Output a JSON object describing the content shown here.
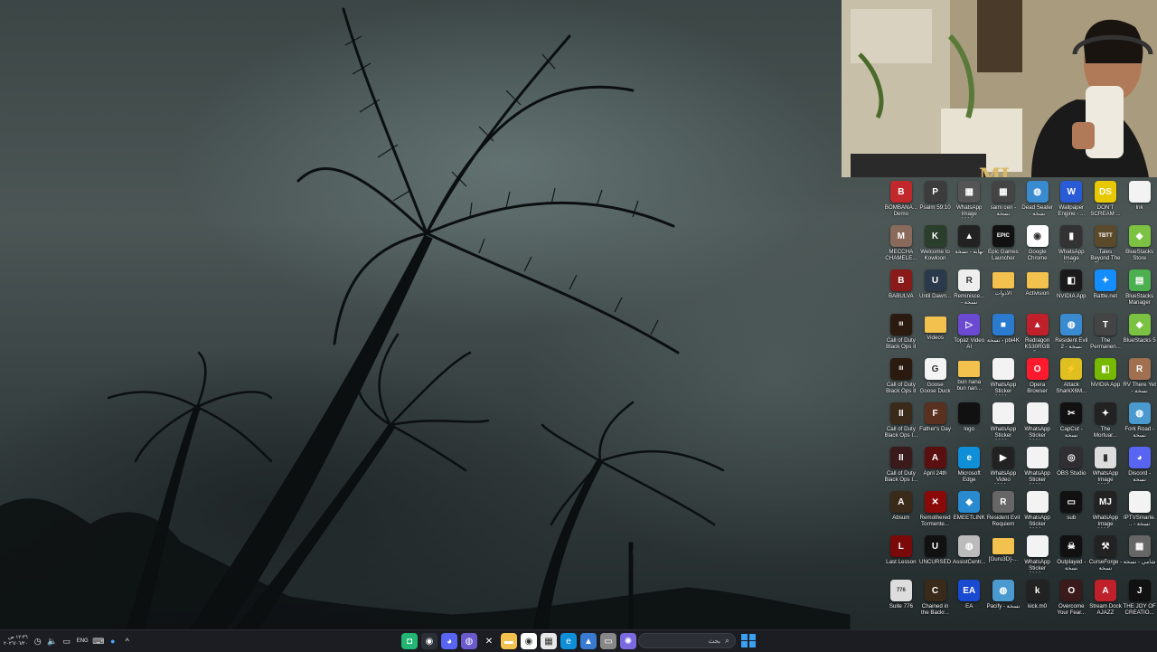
{
  "taskbar": {
    "clock_time": "١٢:٣٦ ص",
    "clock_date": "٢٠٢٦/٠٦/٢٠",
    "language": "ENG",
    "search_placeholder": "بحث"
  },
  "colors": {
    "taskbar_bg": "#1b1d22",
    "accent_start": "#3aa0f0"
  },
  "webcam": {
    "overlay_logo": "MJ"
  },
  "desktop_icons": [
    {
      "label": "BOMBANA... Demo",
      "icon": "game-icon",
      "bg": "#c0282b",
      "glyph": "B"
    },
    {
      "label": "Psalm 59:10",
      "icon": "app-icon",
      "bg": "#3c3c3c",
      "glyph": "P"
    },
    {
      "label": "WhatsApp Image 2026...",
      "icon": "image-icon",
      "bg": "#555",
      "glyph": "▦"
    },
    {
      "label": "sami cen - نسخة",
      "icon": "image-icon",
      "bg": "#444",
      "glyph": "▦"
    },
    {
      "label": "Dead Seater - نسخة",
      "icon": "globe-icon",
      "bg": "#3a8ad0",
      "glyph": "◍"
    },
    {
      "label": "Wallpaper Engine - ...",
      "icon": "wallpaper-engine-icon",
      "bg": "#2a5bd7",
      "glyph": "W"
    },
    {
      "label": "DON'T SCREAM ...",
      "icon": "game-icon",
      "bg": "#e8c800",
      "glyph": "DS"
    },
    {
      "label": "lnk",
      "icon": "file-icon",
      "bg": "#f3f3f3",
      "glyph": ""
    },
    {
      "label": "MECCHA CHAMELE...",
      "icon": "game-icon",
      "bg": "#8a6a5a",
      "glyph": "M"
    },
    {
      "label": "Welcome to Kowloon",
      "icon": "game-icon",
      "bg": "#2b3d2b",
      "glyph": "K"
    },
    {
      "label": "نهاية - نسخة",
      "icon": "app-icon",
      "bg": "#222",
      "glyph": "▲"
    },
    {
      "label": "Epic Games Launcher",
      "icon": "epic-games-icon",
      "bg": "#111",
      "glyph": "EPIC"
    },
    {
      "label": "Google Chrome",
      "icon": "chrome-icon",
      "bg": "#ffffff",
      "glyph": "◉"
    },
    {
      "label": "WhatsApp Image 2026...",
      "icon": "image-icon",
      "bg": "#333",
      "glyph": "▮"
    },
    {
      "label": "Tales Beyond The Tomb -...",
      "icon": "game-icon",
      "bg": "#5a4a2a",
      "glyph": "TBTT"
    },
    {
      "label": "BlueStacks Store",
      "icon": "bluestacks-icon",
      "bg": "#7cc242",
      "glyph": "◆"
    },
    {
      "label": "BABULVA",
      "icon": "game-icon",
      "bg": "#8a1a1a",
      "glyph": "B"
    },
    {
      "label": "Until Dawn...",
      "icon": "game-icon",
      "bg": "#2a3a4a",
      "glyph": "U"
    },
    {
      "label": "Reminisce... - نسخة",
      "icon": "game-icon",
      "bg": "#eee",
      "glyph": "R"
    },
    {
      "label": "الأدوات",
      "icon": "folder-icon",
      "bg": "#f2c14e",
      "glyph": ""
    },
    {
      "label": "Activision",
      "icon": "folder-icon",
      "bg": "#f2c14e",
      "glyph": ""
    },
    {
      "label": "NVIDIA App",
      "icon": "nvidia-icon",
      "bg": "#1a1a1a",
      "glyph": "◧"
    },
    {
      "label": "Battle.net",
      "icon": "battlenet-icon",
      "bg": "#148eff",
      "glyph": "✦"
    },
    {
      "label": "BlueStacks Manager",
      "icon": "bluestacks-icon",
      "bg": "#4caf50",
      "glyph": "▤"
    },
    {
      "label": "Call of Duty Black Ops II",
      "icon": "game-icon",
      "bg": "#2a1a10",
      "glyph": "III"
    },
    {
      "label": "Videos",
      "icon": "folder-icon",
      "bg": "#f2c14e",
      "glyph": ""
    },
    {
      "label": "Topaz Video AI",
      "icon": "app-icon",
      "bg": "#6a4ad0",
      "glyph": "▷"
    },
    {
      "label": "نسخة - pbi4K",
      "icon": "app-icon",
      "bg": "#2a7ad0",
      "glyph": "■"
    },
    {
      "label": "Redragon K530RGB Pro",
      "icon": "app-icon",
      "bg": "#c0202a",
      "glyph": "▲"
    },
    {
      "label": "Resident Evil 2 - نسخة",
      "icon": "globe-icon",
      "bg": "#3a8ad0",
      "glyph": "◍"
    },
    {
      "label": "The Permanen...",
      "icon": "game-icon",
      "bg": "#444",
      "glyph": "T"
    },
    {
      "label": "BlueStacks 5",
      "icon": "bluestacks-icon",
      "bg": "#7cc242",
      "glyph": "◆"
    },
    {
      "label": "Call of Duty Black Ops II",
      "icon": "game-icon",
      "bg": "#2a1a10",
      "glyph": "III"
    },
    {
      "label": "Goose Goose Duck",
      "icon": "game-icon",
      "bg": "#f4f4f4",
      "glyph": "G"
    },
    {
      "label": "bun nana bun nan...",
      "icon": "folder-icon",
      "bg": "#f2c14e",
      "glyph": ""
    },
    {
      "label": "WhatsApp Sticker 2026...",
      "icon": "file-icon",
      "bg": "#f3f3f3",
      "glyph": ""
    },
    {
      "label": "Opera Browser",
      "icon": "opera-icon",
      "bg": "#ff1b2d",
      "glyph": "O"
    },
    {
      "label": "Attack SharkX6M...",
      "icon": "app-icon",
      "bg": "#e0c020",
      "glyph": "⚡"
    },
    {
      "label": "NVIDIA App",
      "icon": "nvidia-icon",
      "bg": "#76b900",
      "glyph": "◧"
    },
    {
      "label": "RV There Yet - نسخة",
      "icon": "game-icon",
      "bg": "#a07050",
      "glyph": "R"
    },
    {
      "label": "Call of Duty Black Ops I...",
      "icon": "game-icon",
      "bg": "#3a2a1a",
      "glyph": "II"
    },
    {
      "label": "Father's Day",
      "icon": "game-icon",
      "bg": "#5a3020",
      "glyph": "F"
    },
    {
      "label": "logo",
      "icon": "image-icon",
      "bg": "#111",
      "glyph": ""
    },
    {
      "label": "WhatsApp Sticker 2026...",
      "icon": "file-icon",
      "bg": "#f3f3f3",
      "glyph": ""
    },
    {
      "label": "WhatsApp Sticker 2026...",
      "icon": "file-icon",
      "bg": "#f3f3f3",
      "glyph": ""
    },
    {
      "label": "CapCut - نسخة",
      "icon": "capcut-icon",
      "bg": "#111",
      "glyph": "✂"
    },
    {
      "label": "The Mortuar...",
      "icon": "game-icon",
      "bg": "#222",
      "glyph": "✦"
    },
    {
      "label": "Fork Road - نسخة",
      "icon": "globe-icon",
      "bg": "#4a9ad0",
      "glyph": "◍"
    },
    {
      "label": "Call of Duty Black Ops I...",
      "icon": "game-icon",
      "bg": "#3a1a1a",
      "glyph": "II"
    },
    {
      "label": "April 24th",
      "icon": "game-icon",
      "bg": "#5a1010",
      "glyph": "A"
    },
    {
      "label": "Microsoft Edge",
      "icon": "edge-icon",
      "bg": "#0f8fd8",
      "glyph": "e"
    },
    {
      "label": "WhatsApp Video 2026-...",
      "icon": "video-icon",
      "bg": "#222",
      "glyph": "▶"
    },
    {
      "label": "WhatsApp Sticker 2026...",
      "icon": "file-icon",
      "bg": "#f3f3f3",
      "glyph": ""
    },
    {
      "label": "OBS Studio",
      "icon": "obs-icon",
      "bg": "#302e31",
      "glyph": "◎"
    },
    {
      "label": "WhatsApp Image 2026...",
      "icon": "image-icon",
      "bg": "#ddd",
      "glyph": "▮"
    },
    {
      "label": "Discord - نسخة",
      "icon": "discord-icon",
      "bg": "#5865f2",
      "glyph": "◕"
    },
    {
      "label": "Absum",
      "icon": "game-icon",
      "bg": "#3a2a1a",
      "glyph": "A"
    },
    {
      "label": "Remothered Tormente...",
      "icon": "game-icon",
      "bg": "#8a0a0a",
      "glyph": "✕"
    },
    {
      "label": "EMEETLINK",
      "icon": "app-icon",
      "bg": "#2a8ad0",
      "glyph": "◆"
    },
    {
      "label": "Resident Evil Requiem",
      "icon": "game-icon",
      "bg": "#666",
      "glyph": "R"
    },
    {
      "label": "WhatsApp Sticker 2026...",
      "icon": "file-icon",
      "bg": "#f3f3f3",
      "glyph": ""
    },
    {
      "label": "sub",
      "icon": "app-icon",
      "bg": "#111",
      "glyph": "▭"
    },
    {
      "label": "WhatsApp Image 2026...",
      "icon": "image-icon",
      "bg": "#222",
      "glyph": "MJ"
    },
    {
      "label": "IPTVSmarte... - نسخة",
      "icon": "file-icon",
      "bg": "#f3f3f3",
      "glyph": ""
    },
    {
      "label": "Last Lesson",
      "icon": "game-icon",
      "bg": "#7a0a0a",
      "glyph": "L"
    },
    {
      "label": "UNCURSED",
      "icon": "game-icon",
      "bg": "#111",
      "glyph": "U"
    },
    {
      "label": "AssistCentr...",
      "icon": "app-icon",
      "bg": "#bbb",
      "glyph": "◍"
    },
    {
      "label": "[Guru3D]-...",
      "icon": "folder-icon",
      "bg": "#f2c14e",
      "glyph": ""
    },
    {
      "label": "WhatsApp Sticker 2026...",
      "icon": "file-icon",
      "bg": "#f3f3f3",
      "glyph": ""
    },
    {
      "label": "Outplayed - نسخة",
      "icon": "app-icon",
      "bg": "#111",
      "glyph": "☠"
    },
    {
      "label": "CurseForge - نسخة",
      "icon": "curseforge-icon",
      "bg": "#222",
      "glyph": "⚒"
    },
    {
      "label": "شامي - نسخة",
      "icon": "image-icon",
      "bg": "#666",
      "glyph": "▦"
    },
    {
      "label": "Suite 776",
      "icon": "game-icon",
      "bg": "#ddd",
      "glyph": "776"
    },
    {
      "label": "Chained in the Backr...",
      "icon": "game-icon",
      "bg": "#3a2a1a",
      "glyph": "C"
    },
    {
      "label": "EA",
      "icon": "ea-icon",
      "bg": "#1a4ad0",
      "glyph": "EA"
    },
    {
      "label": "Pacify - نسخة",
      "icon": "globe-icon",
      "bg": "#4a9ad0",
      "glyph": "◍"
    },
    {
      "label": "kick.m0",
      "icon": "app-icon",
      "bg": "#222",
      "glyph": "k"
    },
    {
      "label": "Overcome Your Fear...",
      "icon": "game-icon",
      "bg": "#3a1a1a",
      "glyph": "O"
    },
    {
      "label": "Stream Dock AJAZZ",
      "icon": "app-icon",
      "bg": "#c0202a",
      "glyph": "A"
    },
    {
      "label": "THE JOY OF CREATIO...",
      "icon": "game-icon",
      "bg": "#111",
      "glyph": "J"
    }
  ],
  "taskbar_apps": [
    {
      "icon": "app-green-icon",
      "bg": "#22b573",
      "glyph": "◘"
    },
    {
      "icon": "chrome-taskbar-icon",
      "bg": "#2b2f36",
      "glyph": "◉"
    },
    {
      "icon": "discord-taskbar-icon",
      "bg": "#5865f2",
      "glyph": "◕"
    },
    {
      "icon": "app-blue-icon",
      "bg": "#6a5acd",
      "glyph": "◍"
    },
    {
      "icon": "app-dark-icon",
      "bg": "#1b1d22",
      "glyph": "✕"
    },
    {
      "icon": "folder-taskbar-icon",
      "bg": "#f2c14e",
      "glyph": "▬"
    },
    {
      "icon": "chrome-taskbar-icon-2",
      "bg": "#ffffff",
      "glyph": "◉"
    },
    {
      "icon": "store-icon",
      "bg": "#e8e8e8",
      "glyph": "▦"
    },
    {
      "icon": "edge-taskbar-icon",
      "bg": "#0f8fd8",
      "glyph": "e"
    },
    {
      "icon": "photos-icon",
      "bg": "#3a7ad0",
      "glyph": "▲"
    },
    {
      "icon": "window-icon",
      "bg": "#888",
      "glyph": "▭"
    },
    {
      "icon": "copilot-icon",
      "bg": "#7a6ae0",
      "glyph": "✺"
    }
  ]
}
